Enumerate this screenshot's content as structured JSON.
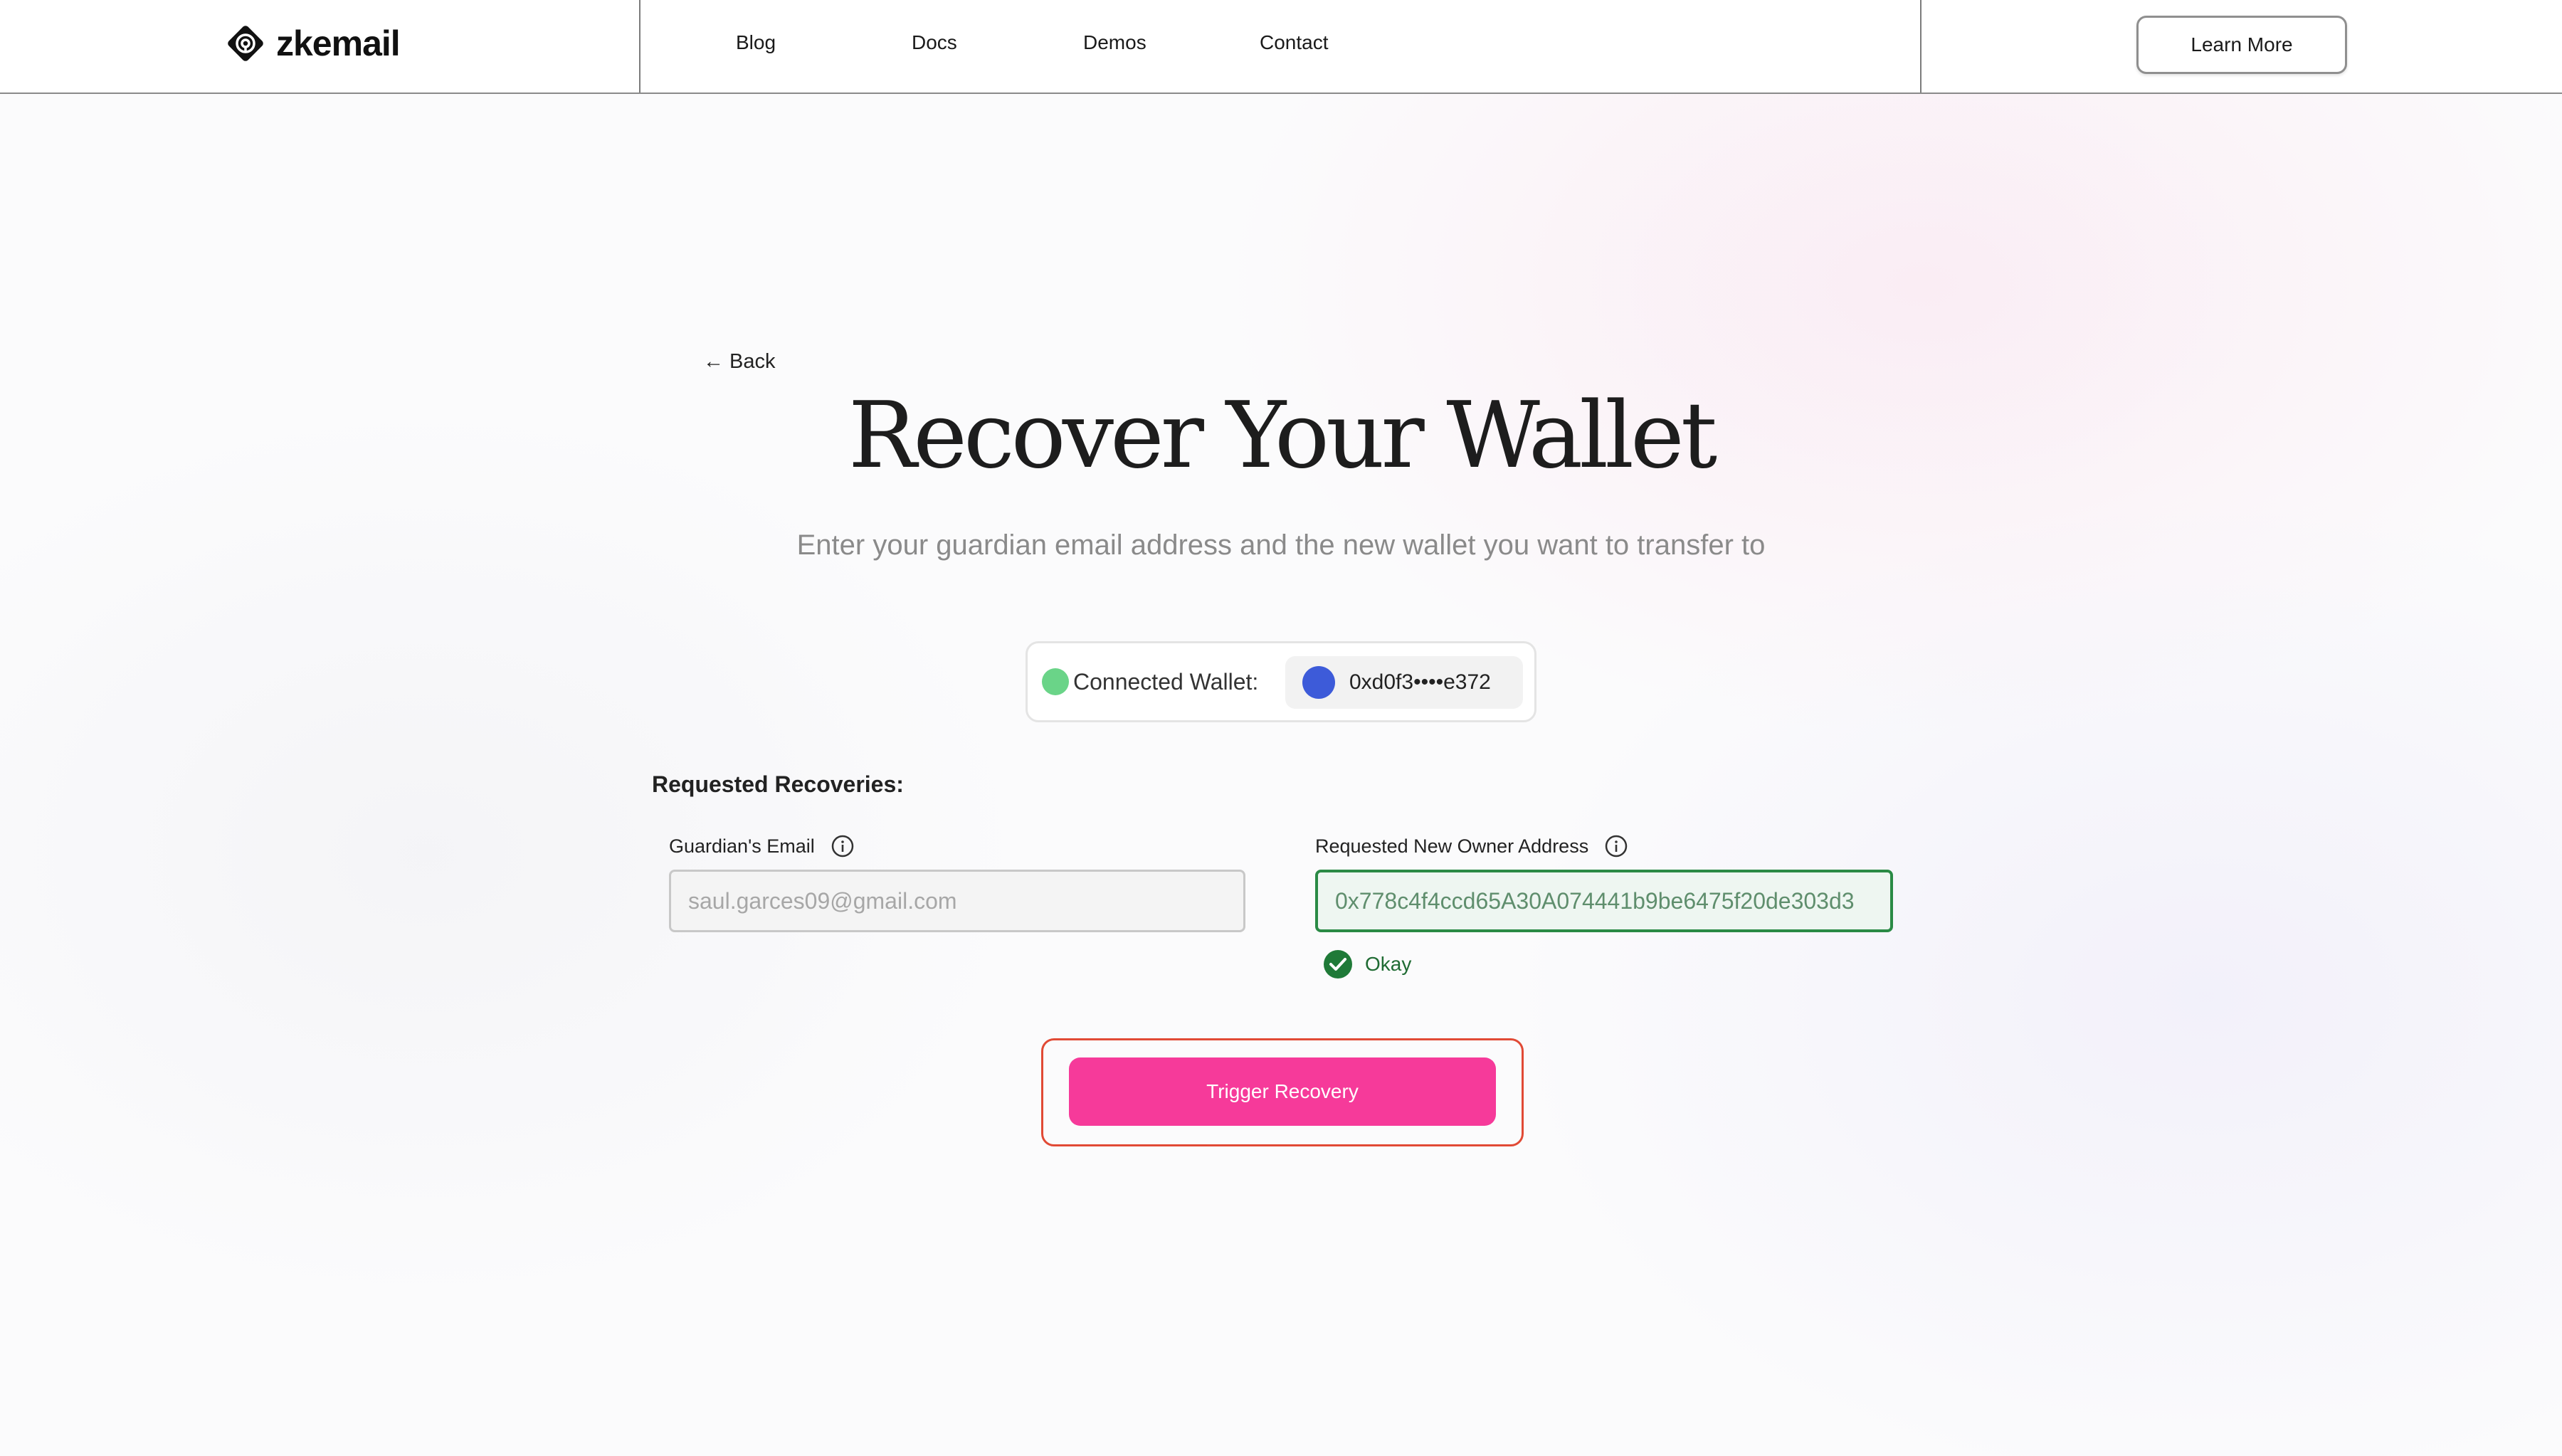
{
  "header": {
    "brand": "zkemail",
    "nav": [
      {
        "label": "Blog"
      },
      {
        "label": "Docs"
      },
      {
        "label": "Demos"
      },
      {
        "label": "Contact"
      }
    ],
    "cta_label": "Learn More"
  },
  "main": {
    "back_label": "Back",
    "title": "Recover Your Wallet",
    "subtitle": "Enter your guardian email address and the new wallet you want to transfer to",
    "connected_wallet": {
      "label": "Connected Wallet:",
      "address": "0xd0f3••••e372",
      "status_color": "#6ad488",
      "avatar_color": "#3d5bd9"
    },
    "section_label": "Requested Recoveries:",
    "guardian_email": {
      "label": "Guardian's Email",
      "value": "saul.garces09@gmail.com"
    },
    "new_owner": {
      "label": "Requested New Owner Address",
      "value": "0x778c4f4ccd65A30A074441b9be6475f20de303d3",
      "validation": "Okay",
      "validation_color": "#2a8a45"
    },
    "trigger_label": "Trigger Recovery",
    "accent_color": "#f63a9a"
  }
}
